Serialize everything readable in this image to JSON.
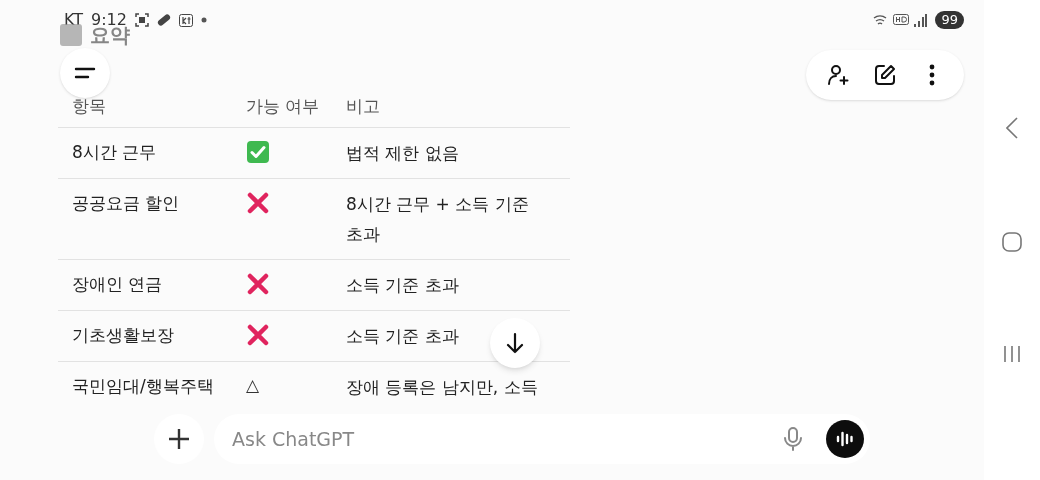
{
  "status_bar": {
    "carrier": "KT",
    "time": "9:12",
    "battery": "99"
  },
  "heading": "요약",
  "table": {
    "columns": [
      "항목",
      "가능 여부",
      "비고"
    ],
    "rows": [
      {
        "item": "8시간 근무",
        "availability": {
          "kind": "check"
        },
        "note": "법적 제한 없음"
      },
      {
        "item": "공공요금 할인",
        "availability": {
          "kind": "cross"
        },
        "note": "8시간 근무 + 소득 기준 초과"
      },
      {
        "item": "장애인 연금",
        "availability": {
          "kind": "cross"
        },
        "note": "소득 기준 초과"
      },
      {
        "item": "기초생활보장",
        "availability": {
          "kind": "cross"
        },
        "note": "소득 기준 초과"
      },
      {
        "item": "국민임대/행복주택",
        "availability": {
          "kind": "text",
          "text": "△"
        },
        "note": "장애 등록은 남지만, 소득"
      }
    ]
  },
  "composer": {
    "placeholder": "Ask ChatGPT"
  }
}
